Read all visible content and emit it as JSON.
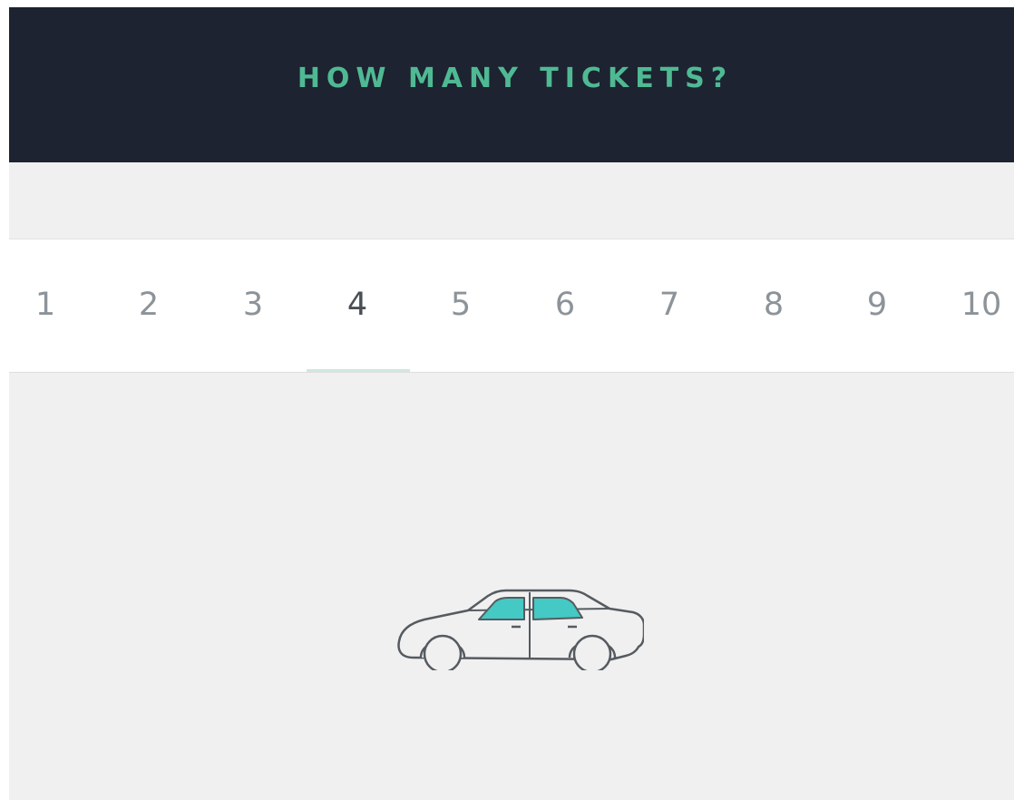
{
  "header": {
    "title": "HOW MANY TICKETS?"
  },
  "ticket_selector": {
    "options": [
      "1",
      "2",
      "3",
      "4",
      "5",
      "6",
      "7",
      "8",
      "9",
      "10"
    ],
    "selected": "4"
  },
  "illustration": {
    "icon": "car-icon",
    "window_color": "#44c9c4",
    "outline_color": "#555b60"
  },
  "colors": {
    "header_bg": "#1d2330",
    "accent": "#4fb993",
    "page_bg": "#f0f0f0"
  }
}
